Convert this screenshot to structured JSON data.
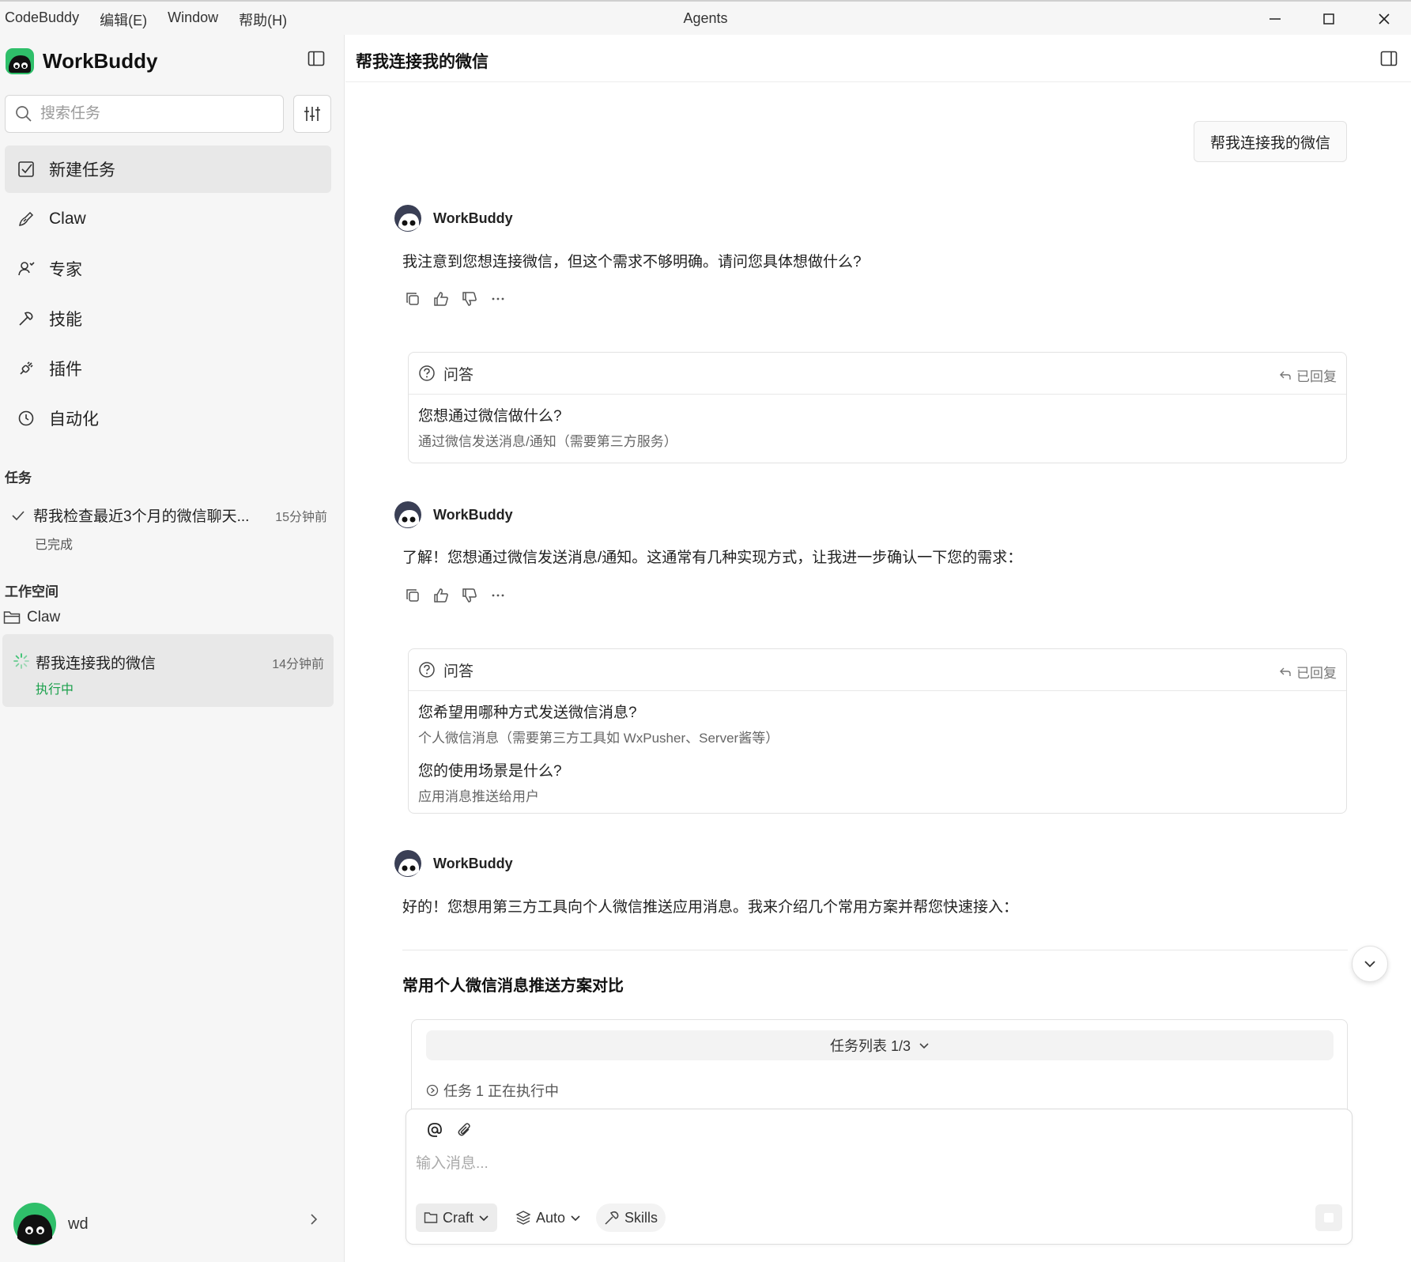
{
  "menubar": {
    "items": [
      "CodeBuddy",
      "编辑(E)",
      "Window",
      "帮助(H)"
    ],
    "window_title": "Agents"
  },
  "sidebar": {
    "brand": "WorkBuddy",
    "search_placeholder": "搜索任务",
    "nav": [
      {
        "label": "新建任务",
        "icon": "new-task-icon"
      },
      {
        "label": "Claw",
        "icon": "claw-icon"
      },
      {
        "label": "专家",
        "icon": "experts-icon"
      },
      {
        "label": "技能",
        "icon": "skills-icon"
      },
      {
        "label": "插件",
        "icon": "plugin-icon"
      },
      {
        "label": "自动化",
        "icon": "clock-icon"
      }
    ],
    "tasks_section": "任务",
    "tasks": [
      {
        "title": "帮我检查最近3个月的微信聊天...",
        "time": "15分钟前",
        "status": "已完成"
      }
    ],
    "workspace_section": "工作空间",
    "workspace_folder": "Claw",
    "workspace_task": {
      "title": "帮我连接我的微信",
      "time": "14分钟前",
      "status": "执行中"
    },
    "user": {
      "name": "wd"
    }
  },
  "main": {
    "title": "帮我连接我的微信",
    "user_message": "帮我连接我的微信",
    "bot_name": "WorkBuddy",
    "messages": [
      "我注意到您想连接微信，但这个需求不够明确。请问您具体想做什么?",
      "了解！您想通过微信发送消息/通知。这通常有几种实现方式，让我进一步确认一下您的需求：",
      "好的！您想用第三方工具向个人微信推送应用消息。我来介绍几个常用方案并帮您快速接入："
    ],
    "qa_label": "问答",
    "qa_replied": "已回复",
    "qa1": [
      {
        "q": "您想通过微信做什么?",
        "a": "通过微信发送消息/通知（需要第三方服务）"
      }
    ],
    "qa2": [
      {
        "q": "您希望用哪种方式发送微信消息?",
        "a": "个人微信消息（需要第三方工具如 WxPusher、Server酱等）"
      },
      {
        "q": "您的使用场景是什么?",
        "a": "应用消息推送给用户"
      }
    ],
    "compare_heading": "常用个人微信消息推送方案对比",
    "tasklist_label": "任务列表 1/3",
    "task_running": "任务 1 正在执行中"
  },
  "composer": {
    "placeholder": "输入消息...",
    "mode": "Craft",
    "model": "Auto",
    "skills": "Skills"
  },
  "colors": {
    "accent_green": "#1aa04b",
    "sidebar_bg": "#f6f6f6",
    "active_bg": "#e8e8e8"
  }
}
